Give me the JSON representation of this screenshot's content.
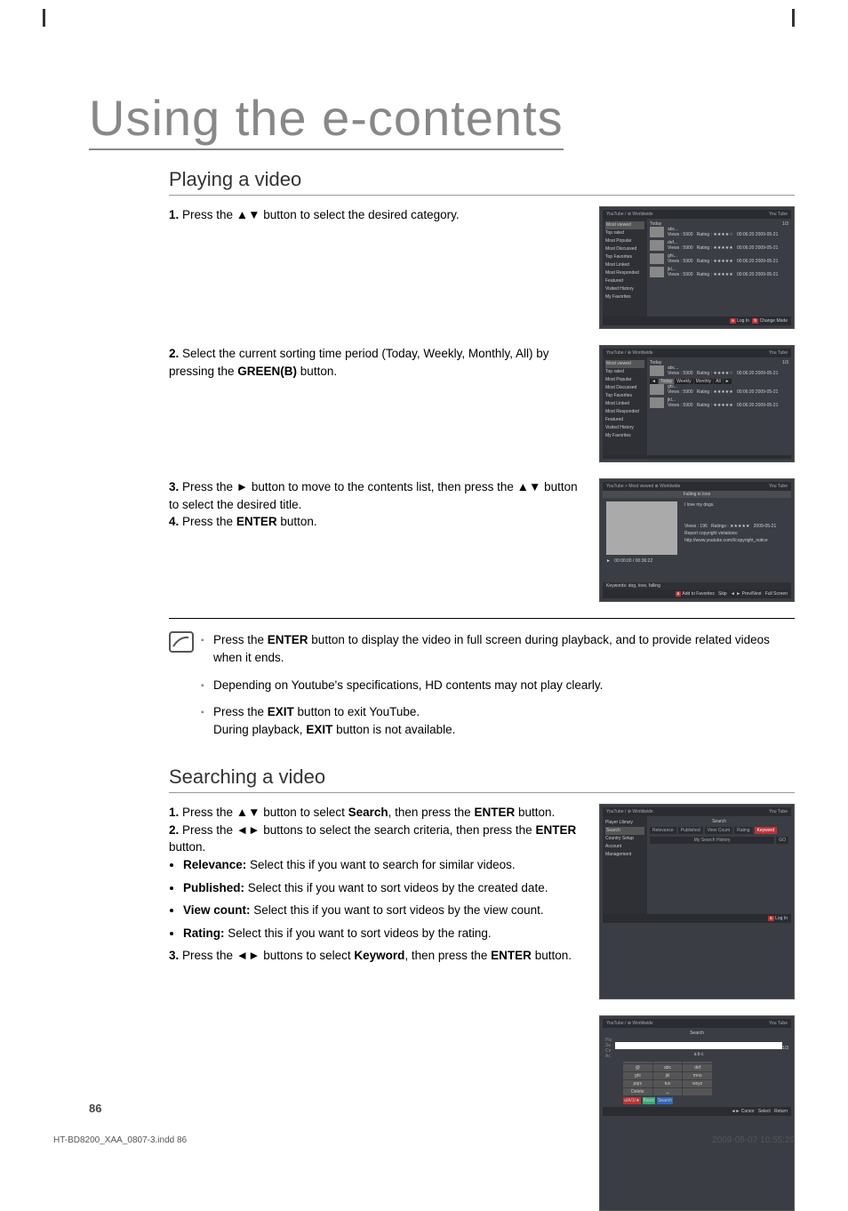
{
  "chapter_title": "Using the e-contents",
  "section1": {
    "heading": "Playing a video",
    "step1": "Press the ▲▼ button to select the desired category.",
    "step2_a": "Select the current sorting time period (Today, Weekly, Monthly, All) by pressing the ",
    "step2_green": "GREEN(B)",
    "step2_b": " button.",
    "step3": "Press the ►  button to move to the contents list, then press the ▲▼ button to select the desired title.",
    "step4_a": "Press the ",
    "step4_enter": "ENTER",
    "step4_b": " button."
  },
  "notes": {
    "n1_a": "Press the ",
    "n1_enter": "ENTER",
    "n1_b": " button to display the video in full screen during playback, and to provide related videos when it ends.",
    "n2": "Depending on Youtube's specifications, HD contents may not play clearly.",
    "n3_a": "Press the ",
    "n3_exit1": "EXIT",
    "n3_b": " button to exit YouTube.",
    "n3_c": "During playback, ",
    "n3_exit2": "EXIT",
    "n3_d": " button is not available."
  },
  "section2": {
    "heading": "Searching a video",
    "step1_a": "Press the ▲▼ button to select ",
    "step1_search": "Search",
    "step1_b": ", then press the ",
    "step1_enter": "ENTER",
    "step1_c": " button.",
    "step2_a": "Press the ◄► buttons to select the search criteria, then press the ",
    "step2_enter": "ENTER",
    "step2_b": " button.",
    "bullet_rel_label": "Relevance:",
    "bullet_rel_text": " Select this if you want to search for similar videos.",
    "bullet_pub_label": "Published:",
    "bullet_pub_text": " Select this if you want to sort videos by the created date.",
    "bullet_vc_label": "View count:",
    "bullet_vc_text": " Select this if you want to sort videos by the view count.",
    "bullet_rat_label": "Rating:",
    "bullet_rat_text": " Select this if you want to sort videos by the rating.",
    "step3_a": "Press the ◄► buttons to select ",
    "step3_keyword": "Keyword",
    "step3_b": ", then press the ",
    "step3_enter": "ENTER",
    "step3_c": " button."
  },
  "screenshots": {
    "header_title": "YouTube / ⊕ Worldwide",
    "header_title_path": "YouTube > Most viewed   ⊕ Worldwide",
    "logo": "You Tube",
    "page_indicator": "1/3",
    "menu": {
      "items": [
        "Most viewed",
        "Top rated",
        "Most Popular",
        "Most Discussed",
        "Top Favorites",
        "Most Linked",
        "Most Responded",
        "Featured",
        "Visited History",
        "My Favorites"
      ],
      "search_menu": [
        "Player Library",
        "Search",
        "Country Setup",
        "Account Management"
      ]
    },
    "today_label": "Today",
    "videos": [
      {
        "title": "abc...",
        "views": "Views : 5900",
        "rating": "Rating : ★★★★☆",
        "duration": "00:06:20",
        "date": "2009-05-21"
      },
      {
        "title": "def...",
        "views": "Views : 5900",
        "rating": "Rating : ★★★★★",
        "duration": "00:06:20",
        "date": "2009-05-21"
      },
      {
        "title": "ghi...",
        "views": "Views : 5900",
        "rating": "Rating : ★★★★★",
        "duration": "00:06:20",
        "date": "2009-05-21"
      },
      {
        "title": "jkl...",
        "views": "Views : 5900",
        "rating": "Rating : ★★★★★",
        "duration": "00:06:20",
        "date": "2009-05-21"
      }
    ],
    "sort_options": [
      "◄",
      "Today",
      "Weekly",
      "Monthly",
      "All",
      "►"
    ],
    "footer_login": "Log In",
    "footer_change": "Change Mode",
    "footer_a": "a",
    "footer_b": "b",
    "playback": {
      "title": "Falling in love",
      "caption": "I love my dogs.",
      "views": "Views : 196",
      "ratings": "Ratings : ★★★★★",
      "date": "2009-05-21",
      "copyright1": "Report copyright violations:",
      "copyright2": "http://www.youtube.com/t/copyright_notice",
      "time": "00:00:00 / 00:36:22",
      "keywords": "Keywords: dog, love, falling",
      "btn_fav": "Add to Favorites",
      "btn_skip": "Skip",
      "btn_prev": "◄ ► Prev/Next",
      "btn_full": "Full Screen",
      "play_icon": "►"
    },
    "search": {
      "heading": "Search",
      "tabs": [
        "Relevance",
        "Published",
        "View Count",
        "Rating",
        "Keyword"
      ],
      "my_history": "My Search History",
      "go": "GO"
    },
    "keyboard": {
      "typed": "a b c",
      "keys": [
        "",
        "",
        "",
        "@",
        "abc",
        "def",
        "ghi",
        "jkl",
        "mno",
        "pqrs",
        "tuv",
        "wxyz",
        "Delete",
        "␣",
        ""
      ],
      "btn_case": "a/A/1/★",
      "btn_blank": "Blank",
      "btn_search": "Search",
      "footer_cursor": "◄► Cursor",
      "footer_select": "Select",
      "footer_return": "Return"
    }
  },
  "page_number": "86",
  "footer_left": "HT-BD8200_XAA_0807-3.indd   86",
  "footer_right": "2009-08-07   10:55:20"
}
